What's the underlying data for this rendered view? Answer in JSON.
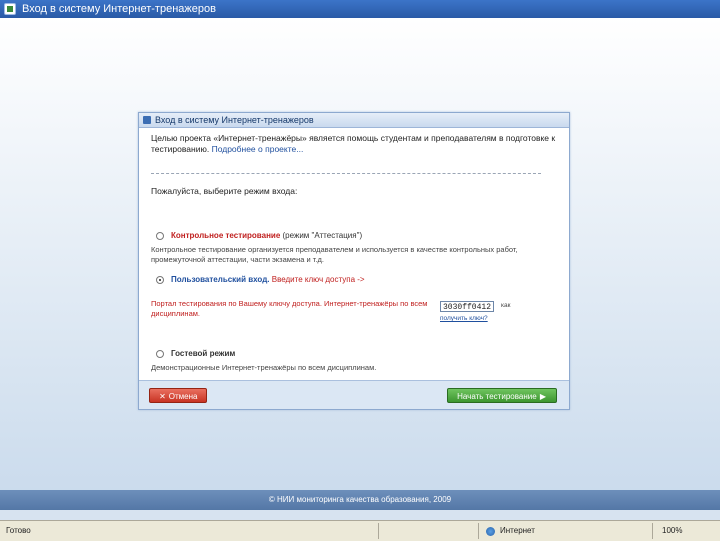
{
  "window": {
    "title": "Вход в систему Интернет-тренажеров"
  },
  "dialog": {
    "header_title": "Вход в систему Интернет-тренажеров",
    "intro_text": "Целью проекта «Интернет-тренажёры» является помощь студентам и преподавателям в подготовке к тестированию.",
    "intro_link": "Подробнее о проекте...",
    "prompt": "Пожалуйста, выберите режим входа:",
    "modes": [
      {
        "name": "Контрольное тестирование",
        "suffix": "(режим \"Аттестация\")",
        "desc": "Контрольное тестирование организуется преподавателем и используется в качестве контрольных работ, промежуточной аттестации, части экзамена и т.д.",
        "selected": false
      },
      {
        "name": "Пользовательский вход.",
        "suffix": "Введите ключ доступа ->",
        "desc": "Портал тестирования по Вашему ключу доступа. Интернет-тренажёры по всем дисциплинам.",
        "selected": true
      },
      {
        "name": "Гостевой режим",
        "suffix": "",
        "desc": "Демонстрационные Интернет-тренажёры по всем дисциплинам.",
        "selected": false
      }
    ],
    "access_key": "3030ff0412",
    "key_hint": "как",
    "key_link": "получить ключ?",
    "cancel_label": "Отмена",
    "start_label": "Начать тестирование"
  },
  "footer": {
    "copyright": "© НИИ мониторинга качества образования, 2009"
  },
  "statusbar": {
    "status": "Готово",
    "zone": "Интернет",
    "zoom": "100%"
  },
  "colors": {
    "accent": "#3c74c8",
    "start_button": "#3d9630",
    "cancel_button": "#c83424"
  }
}
